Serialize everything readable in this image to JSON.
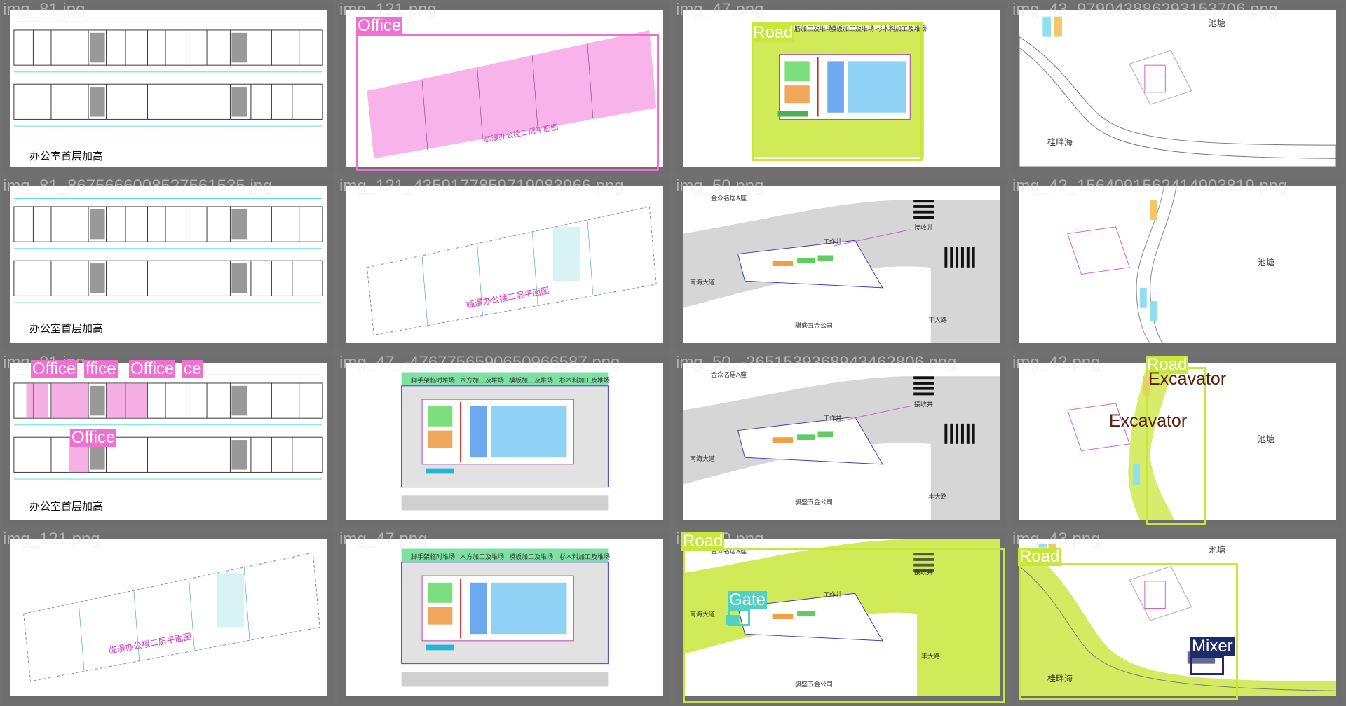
{
  "tiles": [
    {
      "filename": "img_81.jpg",
      "caption": "办公室首层加高",
      "labels": []
    },
    {
      "filename": "img_121.png",
      "caption": "",
      "labels": [
        {
          "text": "Office",
          "color": "#f06fd0"
        }
      ]
    },
    {
      "filename": "img_47.png",
      "caption": "",
      "labels": [
        {
          "text": "Road",
          "color": "#c9e63a"
        }
      ],
      "top_cells": [
        "钢筋加工及堆场",
        "模板加工及堆场",
        "杉木料加工及堆场"
      ]
    },
    {
      "filename": "img_43_979043886293153706.png",
      "caption": "",
      "labels": [],
      "texts": {
        "pond": "池塘",
        "place": "桂畔海"
      }
    },
    {
      "filename": "img_81_8675666008527561535.jpg",
      "caption": "办公室首层加高",
      "labels": []
    },
    {
      "filename": "img_121_4359177859719083966.png",
      "caption": "",
      "labels": [],
      "texts": {
        "title": "临漫办公楼二层平面图"
      }
    },
    {
      "filename": "img_50.png",
      "caption": "",
      "labels": [],
      "texts": {
        "bldg": "金众名居A座",
        "well1": "接收井",
        "well2": "工作井",
        "road1": "南海大道",
        "road2": "丰大路",
        "co": "骐盛五金公司"
      }
    },
    {
      "filename": "img_42_1564091562414903819.png",
      "caption": "",
      "labels": [],
      "texts": {
        "pond": "池塘"
      }
    },
    {
      "filename": "img_81.jpg",
      "caption": "办公室首层加高",
      "labels": [
        {
          "text": "Office",
          "color": "#f06fd0"
        },
        {
          "text": "ffice",
          "color": "#f06fd0"
        },
        {
          "text": "Office",
          "color": "#f06fd0"
        },
        {
          "text": "ce",
          "color": "#f06fd0"
        },
        {
          "text": "Office",
          "color": "#f06fd0"
        }
      ]
    },
    {
      "filename": "img_47_-4767756590650966587.png",
      "caption": "",
      "labels": [],
      "top_cells": [
        "脚手架临时堆场",
        "木方加工及堆场",
        "模板加工及堆场",
        "杉木料加工及堆场"
      ]
    },
    {
      "filename": "img_50_-2651539368943462806.png",
      "caption": "",
      "labels": [],
      "texts": {
        "bldg": "金众名居A座",
        "well1": "接收井",
        "well2": "工作井",
        "road1": "南海大道",
        "road2": "丰大路",
        "co": "骐盛五金公司"
      }
    },
    {
      "filename": "img_42.png",
      "caption": "",
      "labels": [
        {
          "text": "Road",
          "color": "#c9e63a"
        },
        {
          "text": "Excavator",
          "color": "#5a1e0a"
        },
        {
          "text": "Excavator",
          "color": "#5a1e0a"
        }
      ],
      "texts": {
        "pond": "池塘"
      }
    },
    {
      "filename": "img_121.png",
      "caption": "",
      "labels": [],
      "texts": {
        "title": "临漫办公楼二层平面图"
      }
    },
    {
      "filename": "img_47.png",
      "caption": "",
      "labels": [],
      "top_cells": [
        "脚手架临时堆场",
        "木方加工及堆场",
        "模板加工及堆场",
        "杉木料加工及堆场"
      ]
    },
    {
      "filename": "img_50.png",
      "caption": "",
      "labels": [
        {
          "text": "Road",
          "color": "#c9e63a"
        },
        {
          "text": "Gate",
          "color": "#4fd1c5"
        }
      ],
      "texts": {
        "bldg": "金众名居A座",
        "well1": "接收井",
        "well2": "工作井",
        "road1": "南海大道",
        "road2": "丰大路",
        "co": "骐盛五金公司"
      }
    },
    {
      "filename": "img_43.png",
      "caption": "",
      "labels": [
        {
          "text": "Road",
          "color": "#c9e63a"
        },
        {
          "text": "Mixer",
          "color": "#1f2a6b"
        }
      ],
      "texts": {
        "pond": "池塘",
        "place": "桂畔海"
      }
    }
  ]
}
